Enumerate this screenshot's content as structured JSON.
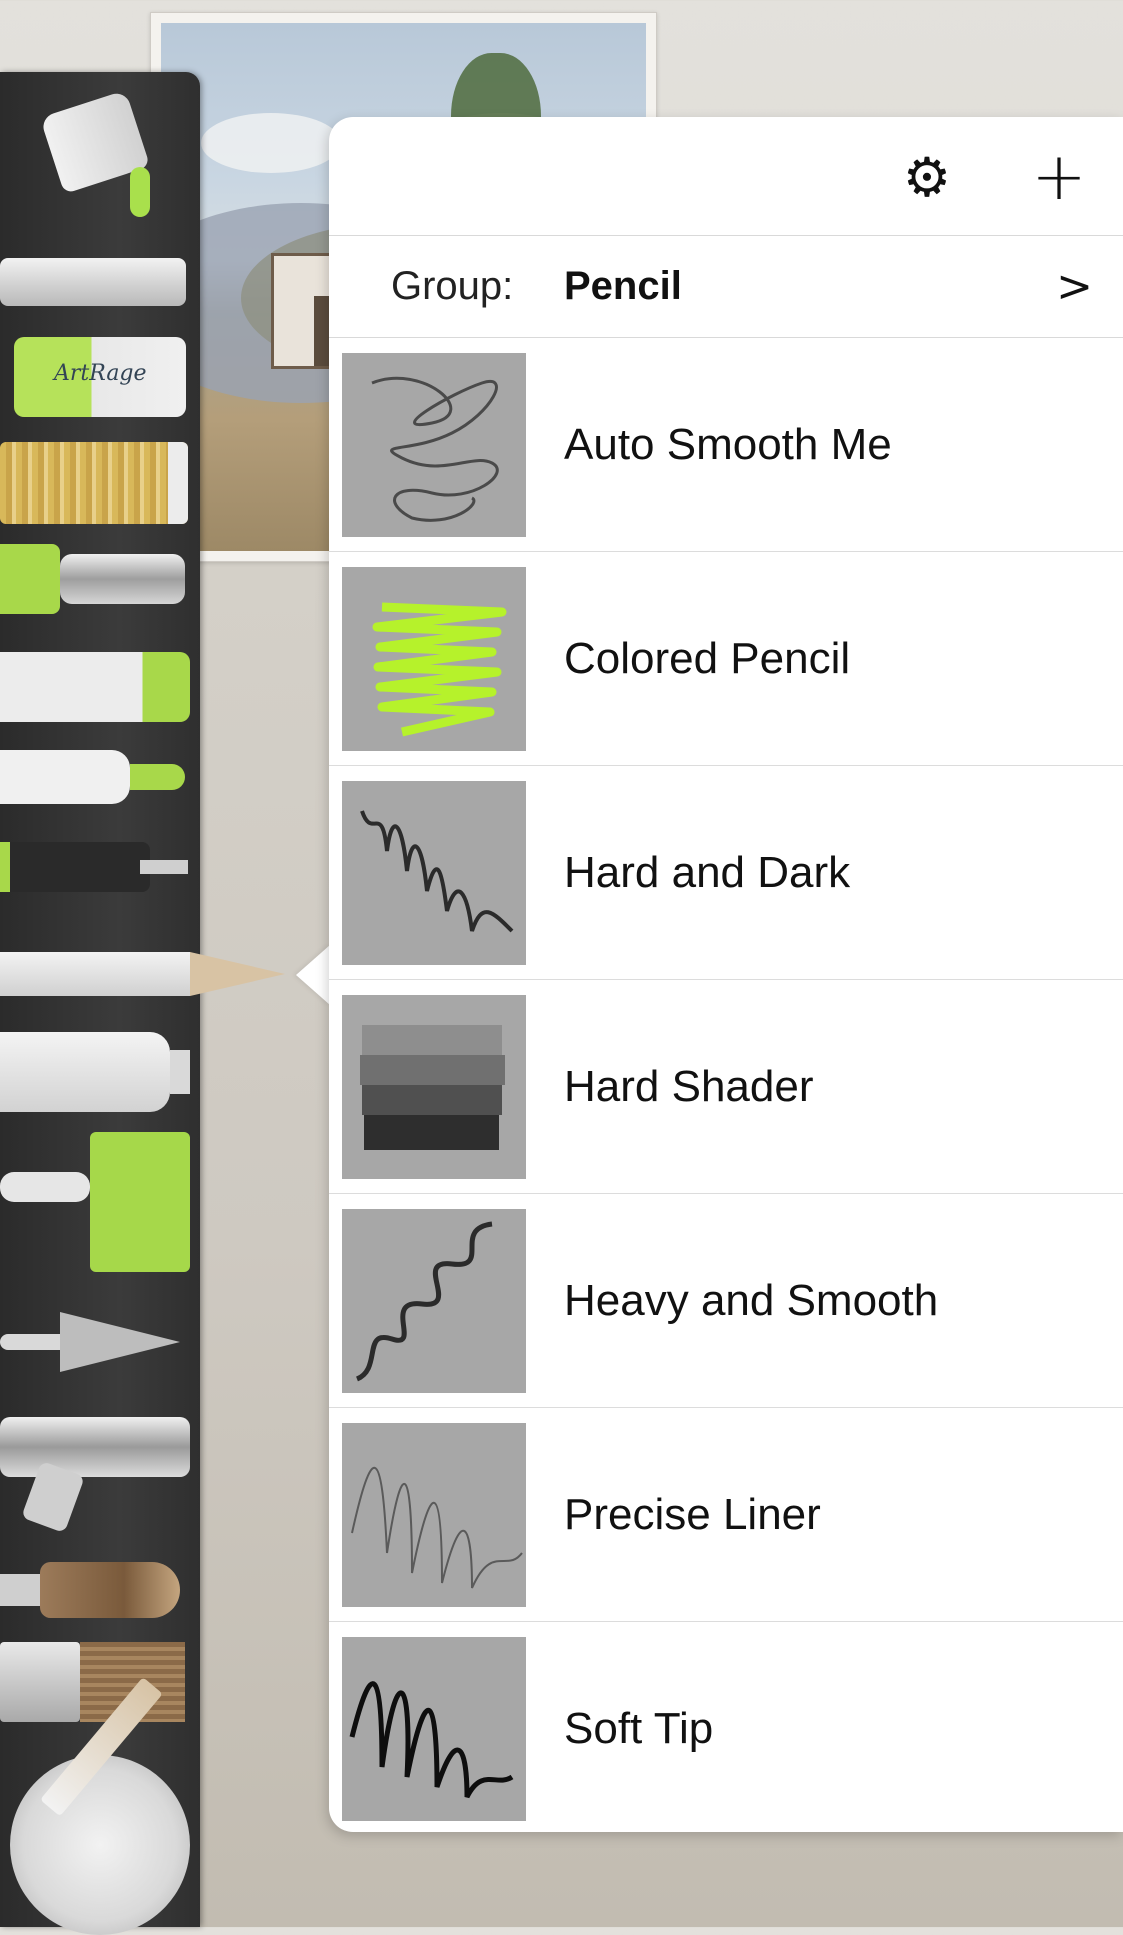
{
  "toolbar": {
    "sticker_label": "ArtRage"
  },
  "popover": {
    "settings_icon": "gear-icon",
    "add_icon": "plus-icon",
    "group_label": "Group:",
    "group_value": "Pencil",
    "group_chevron": ">",
    "presets": [
      {
        "name": "Auto Smooth Me"
      },
      {
        "name": "Colored Pencil"
      },
      {
        "name": "Hard and Dark"
      },
      {
        "name": "Hard Shader"
      },
      {
        "name": "Heavy and Smooth"
      },
      {
        "name": "Precise Liner"
      },
      {
        "name": "Soft Tip"
      }
    ]
  },
  "colors": {
    "accent_green": "#a8d84a",
    "thumb_bg": "#a7a7a7",
    "popover_bg": "#ffffff"
  }
}
